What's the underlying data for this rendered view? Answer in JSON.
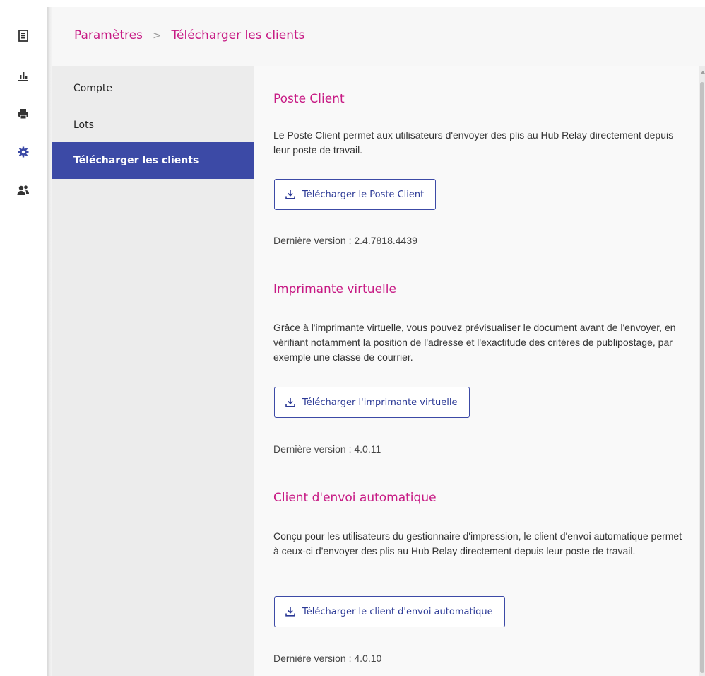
{
  "rail": {
    "icons": [
      "document-icon",
      "bar-chart-icon",
      "printer-icon",
      "gear-icon",
      "users-icon"
    ],
    "active_color": "#3c4aa6"
  },
  "breadcrumb": {
    "root": "Paramètres",
    "separator": ">",
    "current": "Télécharger les clients"
  },
  "nav": {
    "items": [
      {
        "label": "Compte"
      },
      {
        "label": "Lots"
      },
      {
        "label": "Télécharger les clients"
      }
    ],
    "active_index": 2
  },
  "sections": [
    {
      "title": "Poste Client",
      "description": "Le Poste Client permet aux utilisateurs d'envoyer des plis au Hub Relay directement depuis leur poste de travail.",
      "button_label": "Télécharger le Poste Client",
      "version": "Dernière version : 2.4.7818.4439"
    },
    {
      "title": "Imprimante virtuelle",
      "description": "Grâce à l'imprimante virtuelle, vous pouvez prévisualiser le document avant de l'envoyer, en vérifiant notamment la position de l'adresse et l'exactitude des critères de publipostage, par exemple une classe de courrier.",
      "button_label": "Télécharger l'imprimante virtuelle",
      "version": "Dernière version : 4.0.11"
    },
    {
      "title": "Client d'envoi automatique",
      "description": "Conçu pour les utilisateurs du gestionnaire d'impression, le client d'envoi automatique permet à ceux-ci d'envoyer des plis au Hub Relay directement depuis leur poste de travail.",
      "button_label": "Télécharger le client d'envoi automatique",
      "version": "Dernière version : 4.0.10"
    }
  ],
  "colors": {
    "accent": "#c71a84",
    "primary": "#3c4aa6"
  }
}
